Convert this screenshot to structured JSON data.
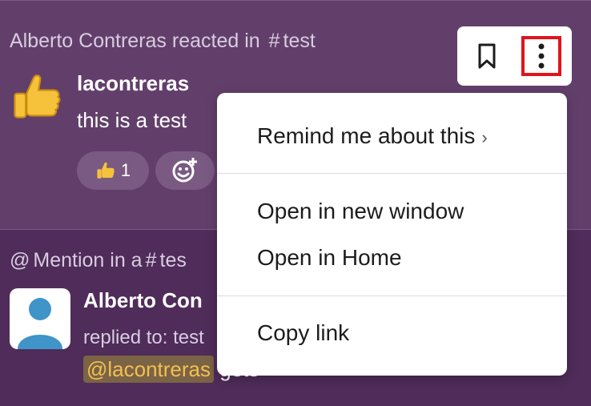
{
  "activity_reaction": {
    "header": "Alberto Contreras reacted in",
    "channel": "test",
    "author": "lacontreras",
    "message": "this is a test",
    "reaction_count": "1",
    "reaction_emoji": "thumbs-up"
  },
  "activity_mention": {
    "header_prefix": "Mention in a",
    "channel": "tes",
    "author": "Alberto Con",
    "replied": "replied to: test",
    "mention_tag": "@lacontreras",
    "mention_rest": " gets"
  },
  "toolbar": {
    "bookmark_icon": "bookmark-icon",
    "more_icon": "more-vertical-icon"
  },
  "menu": {
    "remind": "Remind me about this",
    "open_window": "Open in new window",
    "open_home": "Open in Home",
    "copy_link": "Copy link"
  },
  "colors": {
    "background": "#5e3a67",
    "highlight_outline": "#e0141c",
    "mention_text": "#f2c04f"
  }
}
